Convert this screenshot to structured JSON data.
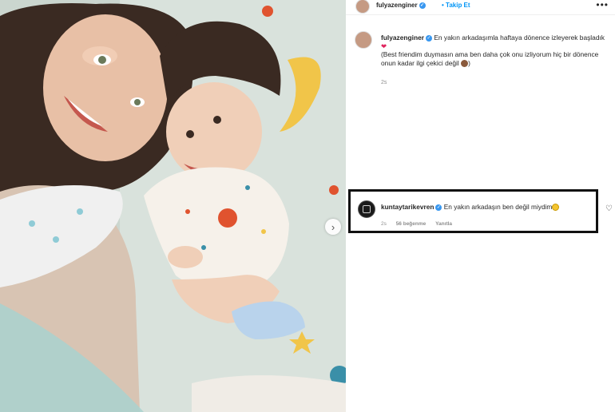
{
  "post": {
    "username": "fulyazenginer",
    "follow_label": "Takip Et",
    "more_label": "•••"
  },
  "caption": {
    "username": "fulyazenginer",
    "text": "En yakın arkadaşımla haftaya dönence izleyerek başladık",
    "text2": "(Best friendim duymasın ama ben daha çok onu izliyorum hiç bir dönence onun kadar ilgi çekici değil",
    "time": "2s"
  },
  "comment": {
    "username": "kuntaytarikevren",
    "text": "En yakın arkadaşın ben değil miydim",
    "time": "2s",
    "likes": "56 beğenme",
    "reply": "Yanıtla"
  },
  "colors": {
    "verified": "#3897f0",
    "follow": "#0095f6",
    "highlight_border": "#111111"
  }
}
